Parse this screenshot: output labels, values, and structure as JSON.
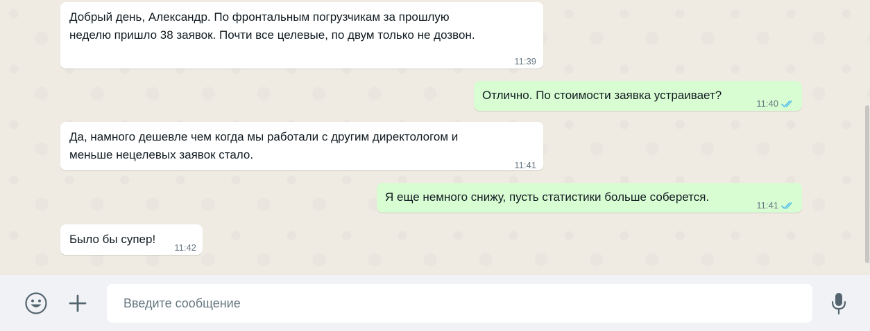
{
  "messages": [
    {
      "direction": "in",
      "text": "Добрый день, Александр. По фронтальным погрузчикам за прошлую\nнеделю пришло 38 заявок. Почти все целевые, по двум только не дозвон.",
      "time": "11:39"
    },
    {
      "direction": "out",
      "text": "Отлично. По стоимости заявка устраивает?",
      "time": "11:40",
      "status": "read"
    },
    {
      "direction": "in",
      "text": "Да, намного дешевле чем когда мы работали с другим директологом и\nменьше нецелевых заявок стало.",
      "time": "11:41"
    },
    {
      "direction": "out",
      "text": "Я еще немного снижу, пусть статистики больше соберется.",
      "time": "11:41",
      "status": "read"
    },
    {
      "direction": "in",
      "text": "Было бы супер!",
      "time": "11:42"
    }
  ],
  "composer": {
    "placeholder": "Введите сообщение",
    "value": "",
    "emoji_icon": "emoji-icon",
    "attach_icon": "plus-icon",
    "mic_icon": "microphone-icon"
  },
  "colors": {
    "chat_bg": "#efeae2",
    "incoming_bubble": "#ffffff",
    "outgoing_bubble": "#d9fdd3",
    "read_ticks": "#53bdeb",
    "composer_bg": "#f0f2f5"
  }
}
